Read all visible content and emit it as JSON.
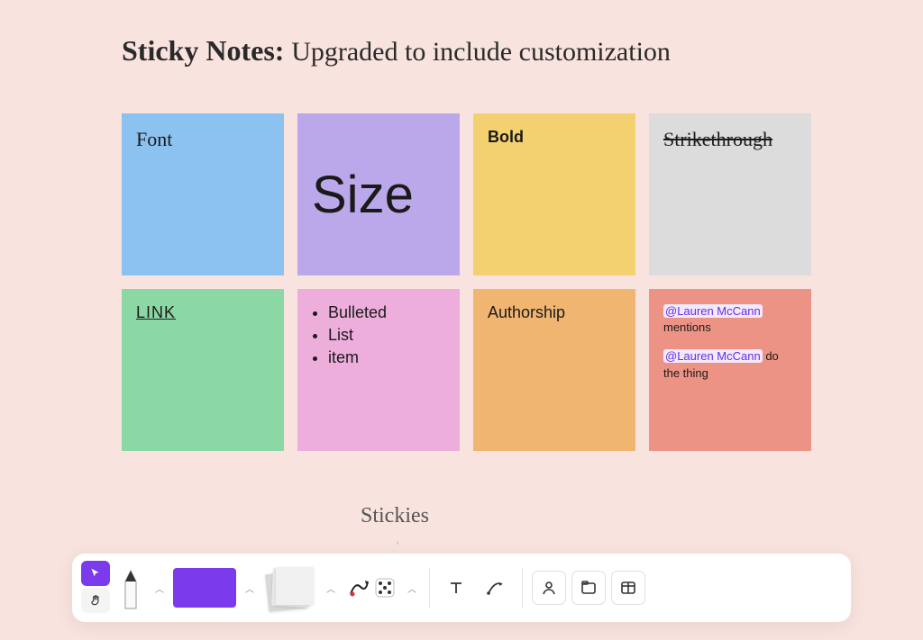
{
  "title": {
    "bold": "Sticky Notes:",
    "rest": "Upgraded to include customization"
  },
  "notes": [
    {
      "id": "font",
      "text": "Font",
      "bg": "#8cc2f0",
      "style": "handwrite"
    },
    {
      "id": "size",
      "text": "Size",
      "bg": "#bba8ea",
      "style": "big"
    },
    {
      "id": "bold",
      "text": "Bold",
      "bg": "#f3d171",
      "style": "bold"
    },
    {
      "id": "strike",
      "text": "Strikethrough",
      "bg": "#dcdcdc",
      "style": "strike-handwrite"
    },
    {
      "id": "link",
      "text": "LINK",
      "bg": "#8cd8a5",
      "style": "link"
    },
    {
      "id": "bullets",
      "bg": "#edaedc",
      "style": "bullets",
      "items": [
        "Bulleted",
        "List",
        "item"
      ]
    },
    {
      "id": "authorship",
      "text": "Authorship",
      "bg": "#f0b571",
      "style": "plain"
    },
    {
      "id": "mentions",
      "bg": "#ed9385",
      "style": "mentions",
      "blocks": [
        {
          "mention": "@Lauren McCann",
          "rest": "mentions"
        },
        {
          "mention": "@Lauren McCann",
          "rest": "do the thing"
        }
      ]
    }
  ],
  "stickies_label": "Stickies",
  "toolbar": {
    "icons": {
      "cursor": "cursor-icon",
      "hand": "hand-icon",
      "pencil": "pencil-icon",
      "shape": "shape-icon",
      "sticky": "sticky-stack-icon",
      "stamp": "stamp-icon",
      "text": "text-icon",
      "connector": "connector-icon",
      "frame": "frame-icon",
      "section": "section-icon",
      "table": "table-icon"
    }
  }
}
